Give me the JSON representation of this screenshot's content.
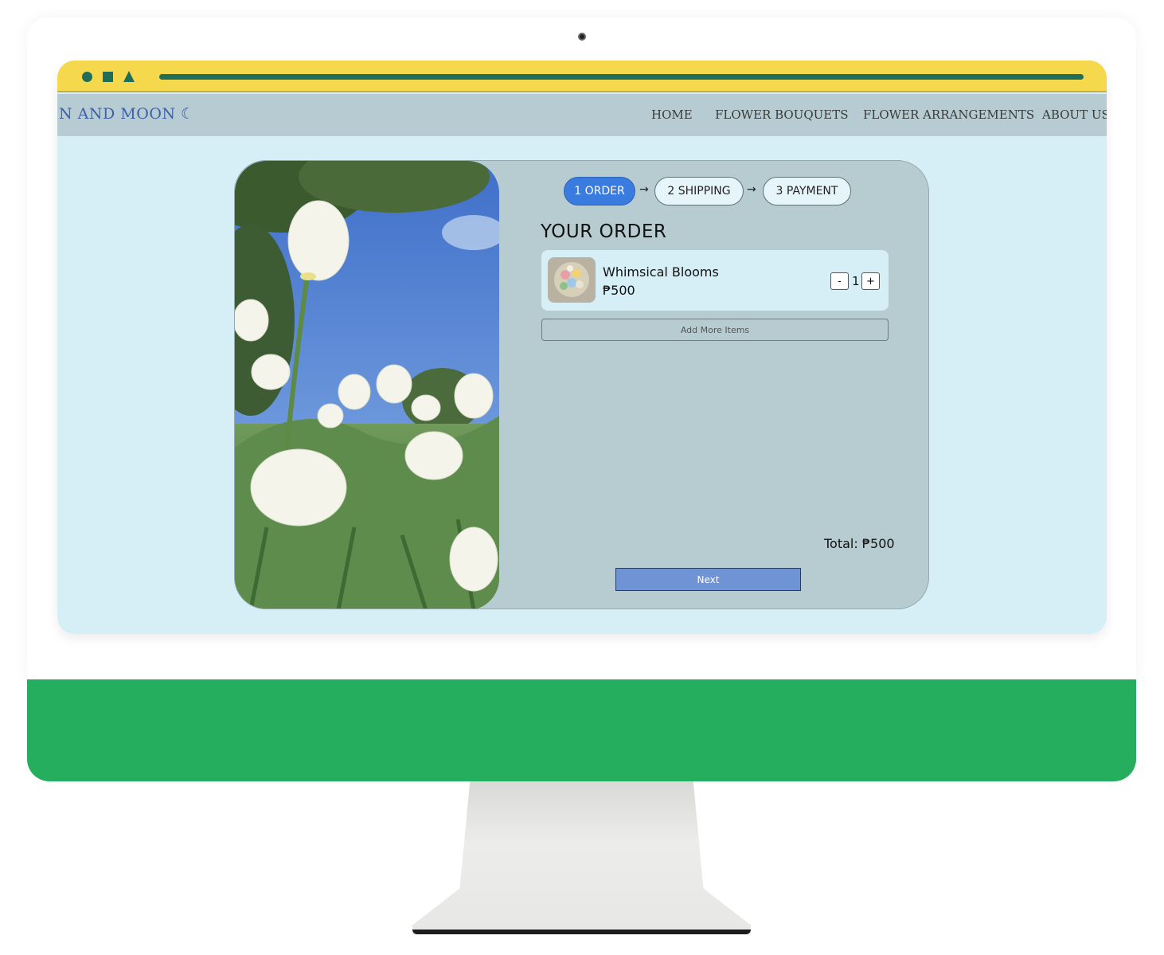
{
  "browser": {
    "controls": [
      "circle-icon",
      "square-icon",
      "triangle-icon"
    ],
    "address_bar": "address-bar"
  },
  "nav": {
    "brand": "N AND MOON ☾",
    "links": [
      "HOME",
      "FLOWER BOUQUETS",
      "FLOWER ARRANGEMENTS",
      "ABOUT US"
    ]
  },
  "checkout": {
    "steps": [
      {
        "label": "1 ORDER",
        "active": true
      },
      {
        "label": "2 SHIPPING",
        "active": false
      },
      {
        "label": "3 PAYMENT",
        "active": false
      }
    ],
    "step_separator": "→",
    "title": "YOUR ORDER",
    "items": [
      {
        "name": "Whimsical Blooms",
        "price": "₱500",
        "quantity": "1"
      }
    ],
    "qty_minus": "-",
    "qty_plus": "+",
    "add_more": "Add More Items",
    "total": "Total: ₱500",
    "next": "Next"
  },
  "colors": {
    "browser_bar": "#f5d84c",
    "nav_bg": "#b6ccd2",
    "screen_bg": "#d6eef6",
    "card_bg": "#b7ccd1",
    "active_step": "#3a7be0",
    "next_button": "#6f93d4",
    "monitor_chin": "#26ae5f"
  }
}
